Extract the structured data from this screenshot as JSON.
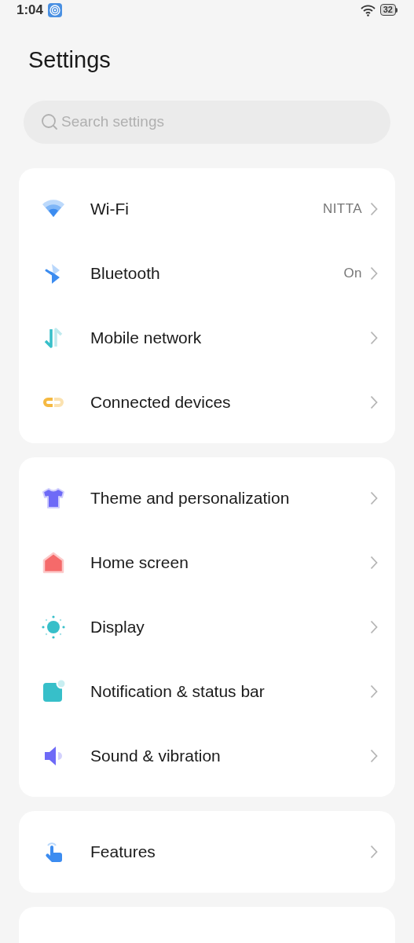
{
  "status_bar": {
    "time": "1:04",
    "battery": "32"
  },
  "title": "Settings",
  "search": {
    "placeholder": "Search settings"
  },
  "groups": [
    {
      "items": [
        {
          "kind": "wifi",
          "label": "Wi-Fi",
          "value": "NITTA"
        },
        {
          "kind": "bluetooth",
          "label": "Bluetooth",
          "value": "On"
        },
        {
          "kind": "mobile",
          "label": "Mobile network"
        },
        {
          "kind": "link",
          "label": "Connected devices"
        }
      ]
    },
    {
      "items": [
        {
          "kind": "shirt",
          "label": "Theme and personalization"
        },
        {
          "kind": "home",
          "label": "Home screen"
        },
        {
          "kind": "sun",
          "label": "Display"
        },
        {
          "kind": "notification",
          "label": "Notification & status bar"
        },
        {
          "kind": "speaker",
          "label": "Sound & vibration"
        }
      ]
    },
    {
      "items": [
        {
          "kind": "touch",
          "label": "Features"
        }
      ]
    }
  ]
}
